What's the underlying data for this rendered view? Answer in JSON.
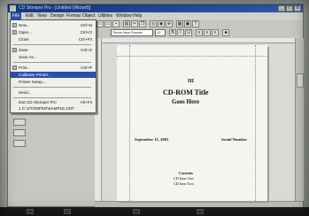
{
  "window": {
    "title": "CD Stomper Pro - [Untitled (Wizard)]"
  },
  "menubar": [
    {
      "label": "File"
    },
    {
      "label": "Edit"
    },
    {
      "label": "View"
    },
    {
      "label": "Design"
    },
    {
      "label": "Format"
    },
    {
      "label": "Object"
    },
    {
      "label": "Utilities"
    },
    {
      "label": "Window"
    },
    {
      "label": "Help"
    }
  ],
  "toolbar": {
    "font_select": "Times New Roman",
    "size_select": "12"
  },
  "file_menu": {
    "items": [
      {
        "label": "New...",
        "shortcut": "Ctrl+N"
      },
      {
        "label": "Open...",
        "shortcut": "Ctrl+O"
      },
      {
        "label": "Close",
        "shortcut": "Ctrl+F4"
      },
      {
        "label": "Save",
        "shortcut": "Ctrl+S"
      },
      {
        "label": "Save As..."
      },
      {
        "label": "Print...",
        "shortcut": "Ctrl+P"
      },
      {
        "label": "Calibrate Printer..."
      },
      {
        "label": "Printer Setup..."
      },
      {
        "label": "Send..."
      },
      {
        "label": "Exit CD Stomper Pro",
        "shortcut": "Alt+F4"
      },
      {
        "label": "1 C:\\STOMPER\\SAMPLE.CDT"
      }
    ]
  },
  "document": {
    "roman_numeral": "III",
    "title": "CD-ROM Title",
    "subtitle": "Goes Here",
    "date": "September 15, 2001",
    "serial": "Serial Number",
    "contents_heading": "Contents",
    "contents_items": [
      "CD Item One",
      "CD Item Two"
    ]
  }
}
